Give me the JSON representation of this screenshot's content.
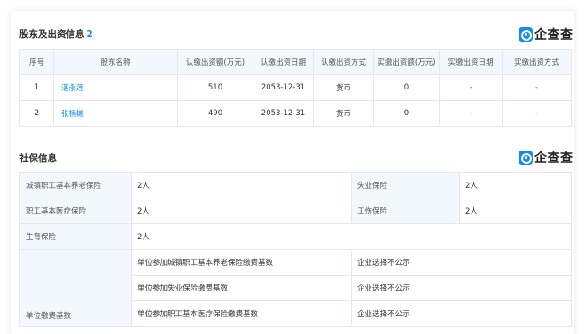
{
  "shareholders": {
    "title": "股东及出资信息",
    "count": "2",
    "logo_text": "企查查",
    "headers": [
      "序号",
      "股东名称",
      "认缴出资额(万元)",
      "认缴出资日期",
      "认缴出资方式",
      "实缴出资额(万元)",
      "实缴出资日期",
      "实缴出资方式"
    ],
    "rows": [
      {
        "no": "1",
        "name": "湛永莲",
        "sub_amount": "510",
        "sub_date": "2053-12-31",
        "sub_method": "货币",
        "paid_amount": "0",
        "paid_date": "-",
        "paid_method": "-"
      },
      {
        "no": "2",
        "name": "张楠樾",
        "sub_amount": "490",
        "sub_date": "2053-12-31",
        "sub_method": "货币",
        "paid_amount": "0",
        "paid_date": "-",
        "paid_method": "-"
      }
    ]
  },
  "social": {
    "title": "社保信息",
    "logo_text": "企查查",
    "rows": [
      {
        "label1": "城镇职工基本养老保险",
        "value1": "2人",
        "label2": "失业保险",
        "value2": "2人"
      },
      {
        "label1": "职工基本医疗保险",
        "value1": "2人",
        "label2": "工伤保险",
        "value2": "2人"
      },
      {
        "label1": "生育保险",
        "value1": "2人"
      }
    ],
    "base": {
      "label": "单位缴费基数",
      "items": [
        {
          "name": "单位参加城镇职工基本养老保险缴费基数",
          "value": "企业选择不公示"
        },
        {
          "name": "单位参加失业保险缴费基数",
          "value": "企业选择不公示"
        },
        {
          "name": "单位参加职工基本医疗保险缴费基数",
          "value": "企业选择不公示"
        }
      ]
    }
  }
}
